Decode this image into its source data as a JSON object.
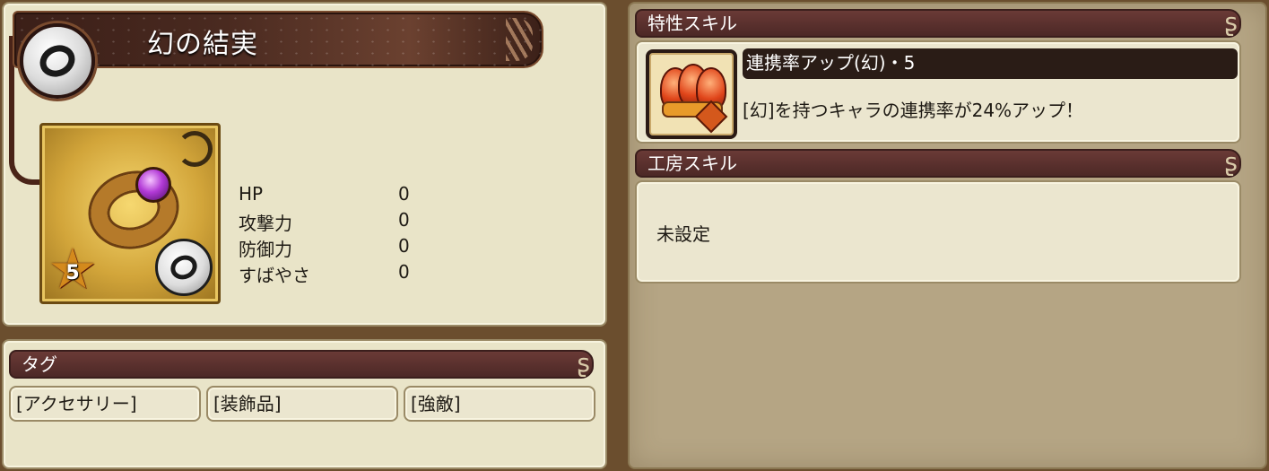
{
  "item": {
    "name": "幻の結実",
    "type_icon": "ring-icon",
    "rarity": "5",
    "stats": [
      {
        "label": "HP",
        "value": "0"
      },
      {
        "label": "攻撃力",
        "value": "0"
      },
      {
        "label": "防御力",
        "value": "0"
      },
      {
        "label": "すばやさ",
        "value": "0"
      }
    ]
  },
  "tags": {
    "header": "タグ",
    "items": [
      "[アクセサリー]",
      "[装飾品]",
      "[強敵]"
    ]
  },
  "trait_skill": {
    "header": "特性スキル",
    "name": "連携率アップ(幻)・5",
    "description": "[幻]を持つキャラの連携率が24%アップ！",
    "icon": "crown-medal-icon"
  },
  "workshop_skill": {
    "header": "工房スキル",
    "value": "未設定"
  },
  "colors": {
    "header_bg": "#5a302c",
    "panel_bg": "#e9e4c8",
    "background": "#6b4e2e"
  }
}
